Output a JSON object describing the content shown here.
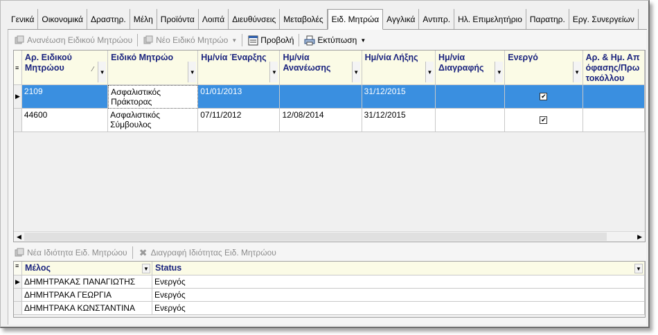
{
  "tabs": [
    {
      "label": "Γενικά"
    },
    {
      "label": "Οικονομικά"
    },
    {
      "label": "Δραστηρ."
    },
    {
      "label": "Μέλη"
    },
    {
      "label": "Προϊόντα"
    },
    {
      "label": "Λοιπά"
    },
    {
      "label": "Διευθύνσεις"
    },
    {
      "label": "Μεταβολές"
    },
    {
      "label": "Ειδ. Μητρώα"
    },
    {
      "label": "Αγγλικά"
    },
    {
      "label": "Αντιπρ."
    },
    {
      "label": "Ηλ. Επιμελητήριο"
    },
    {
      "label": "Παρατηρ."
    },
    {
      "label": "Εργ. Συνεργείων"
    }
  ],
  "active_tab": "Ειδ. Μητρώα",
  "toolbar": {
    "renew_label": "Ανανέωση Ειδικού Μητρώου",
    "new_label": "Νέο Ειδικό Μητρώο",
    "view_label": "Προβολή",
    "print_label": "Εκτύπωση"
  },
  "registry_grid": {
    "columns": [
      {
        "label": "Αρ. Ειδικού Μητρώου",
        "has_sort": true
      },
      {
        "label": "Ειδικό Μητρώο"
      },
      {
        "label": "Ημ/νία Έναρξης"
      },
      {
        "label": "Ημ/νία Ανανέωσης"
      },
      {
        "label": "Ημ/νία Λήξης"
      },
      {
        "label": "Ημ/νία Διαγραφής"
      },
      {
        "label": "Ενεργό"
      },
      {
        "label": "Αρ. & Ημ. Απόφασης/Πρωτοκόλλου"
      }
    ],
    "rows": [
      {
        "number": "2109",
        "registry": "Ασφαλιστικός Πράκτορας",
        "start": "01/01/2013",
        "renewal": "",
        "expiry": "31/12/2015",
        "deletion": "",
        "active": true,
        "decision": "",
        "selected": true
      },
      {
        "number": "44600",
        "registry": "Ασφαλιστικός Σύμβουλος",
        "start": "07/11/2012",
        "renewal": "12/08/2014",
        "expiry": "31/12/2015",
        "deletion": "",
        "active": true,
        "decision": "",
        "selected": false
      }
    ]
  },
  "toolbar2": {
    "new_property_label": "Νέα Ιδιότητα Ειδ. Μητρώου",
    "delete_property_label": "Διαγραφή Ιδιότητας Ειδ. Μητρώου"
  },
  "members_grid": {
    "columns": [
      {
        "label": "Μέλος"
      },
      {
        "label": "Status"
      }
    ],
    "rows": [
      {
        "member": "ΔΗΜΗΤΡΑΚΑΣ ΠΑΝΑΓΙΩΤΗΣ",
        "status": "Ενεργός",
        "selected": true
      },
      {
        "member": "ΔΗΜΗΤΡΑΚΑ ΓΕΩΡΓΙΑ",
        "status": "Ενεργός",
        "selected": false
      },
      {
        "member": "ΔΗΜΗΤΡΑΚΑ ΚΩΝΣΤΑΝΤΙΝΑ",
        "status": "Ενεργός",
        "selected": false
      }
    ]
  }
}
